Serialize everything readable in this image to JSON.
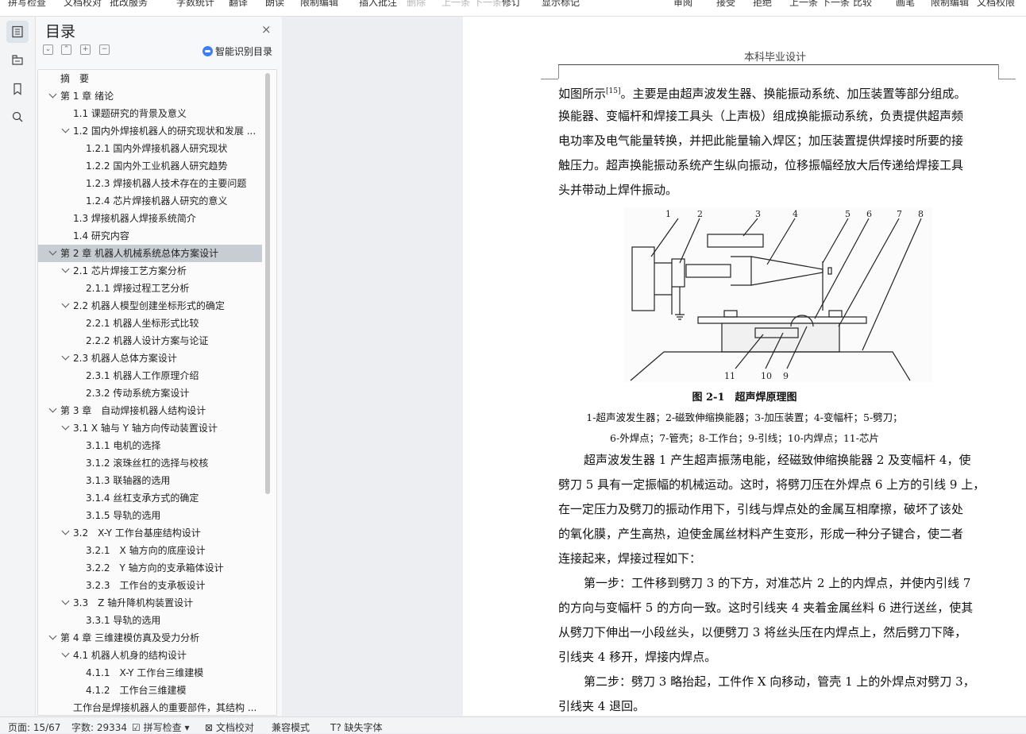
{
  "toolbar": {
    "items": [
      "拼写检查",
      "文档校对",
      "批改服务",
      "字数统计",
      "翻译",
      "朗读",
      "限制编辑",
      "插入批注",
      "删除",
      "上一条",
      "下一条",
      "修订",
      "显示标记",
      "审阅",
      "接受",
      "拒绝",
      "上一条",
      "下一条",
      "比较",
      "画笔",
      "限制编辑",
      "文档权限"
    ]
  },
  "toc": {
    "title": "目录",
    "smart_button": "智能识别目录",
    "close_symbol": "×",
    "rows": [
      {
        "level": 0,
        "chevron": false,
        "text": "摘　要"
      },
      {
        "level": 0,
        "chevron": true,
        "text": "第 1 章  绪论"
      },
      {
        "level": 1,
        "chevron": false,
        "text": "1.1  课题研究的背景及意义"
      },
      {
        "level": 1,
        "chevron": true,
        "text": "1.2  国内外焊接机器人的研究现状和发展 ..."
      },
      {
        "level": 2,
        "chevron": false,
        "text": "1.2.1  国内外焊接机器人研究现状"
      },
      {
        "level": 2,
        "chevron": false,
        "text": "1.2.2  国内外工业机器人研究趋势"
      },
      {
        "level": 2,
        "chevron": false,
        "text": "1.2.3  焊接机器人技术存在的主要问题"
      },
      {
        "level": 2,
        "chevron": false,
        "text": "1.2.4  芯片焊接机器人研究的意义"
      },
      {
        "level": 1,
        "chevron": false,
        "text": "1.3  焊接机器人焊接系统简介"
      },
      {
        "level": 1,
        "chevron": false,
        "text": "1.4  研究内容"
      },
      {
        "level": 0,
        "chevron": true,
        "text": "第 2 章  机器人机械系统总体方案设计",
        "selected": true
      },
      {
        "level": 1,
        "chevron": true,
        "text": "2.1  芯片焊接工艺方案分析"
      },
      {
        "level": 2,
        "chevron": false,
        "text": "2.1.1  焊接过程工艺分析"
      },
      {
        "level": 1,
        "chevron": true,
        "text": "2.2  机器人模型创建坐标形式的确定"
      },
      {
        "level": 2,
        "chevron": false,
        "text": "2.2.1  机器人坐标形式比较"
      },
      {
        "level": 2,
        "chevron": false,
        "text": "2.2.2  机器人设计方案与论证"
      },
      {
        "level": 1,
        "chevron": true,
        "text": "2.3  机器人总体方案设计"
      },
      {
        "level": 2,
        "chevron": false,
        "text": "2.3.1 机器人工作原理介绍"
      },
      {
        "level": 2,
        "chevron": false,
        "text": "2.3.2  传动系统方案设计"
      },
      {
        "level": 0,
        "chevron": true,
        "text": "第 3 章　自动焊接机器人结构设计"
      },
      {
        "level": 1,
        "chevron": true,
        "text": "3.1 X 轴与 Y 轴方向传动装置设计"
      },
      {
        "level": 2,
        "chevron": false,
        "text": "3.1.1  电机的选择"
      },
      {
        "level": 2,
        "chevron": false,
        "text": "3.1.2 滚珠丝杠的选择与校核"
      },
      {
        "level": 2,
        "chevron": false,
        "text": "3.1.3  联轴器的选用"
      },
      {
        "level": 2,
        "chevron": false,
        "text": "3.1.4  丝杠支承方式的确定"
      },
      {
        "level": 2,
        "chevron": false,
        "text": "3.1.5  导轨的选用"
      },
      {
        "level": 1,
        "chevron": true,
        "text": "3.2　X-Y 工作台基座结构设计"
      },
      {
        "level": 2,
        "chevron": false,
        "text": "3.2.1　X 轴方向的底座设计"
      },
      {
        "level": 2,
        "chevron": false,
        "text": "3.2.2　Y 轴方向的支承箱体设计"
      },
      {
        "level": 2,
        "chevron": false,
        "text": "3.2.3　工作台的支承板设计"
      },
      {
        "level": 1,
        "chevron": true,
        "text": "3.3　Z 轴升降机构装置设计"
      },
      {
        "level": 2,
        "chevron": false,
        "text": "3.3.1  导轨的选用"
      },
      {
        "level": 0,
        "chevron": true,
        "text": "第 4 章  三维建模仿真及受力分析"
      },
      {
        "level": 1,
        "chevron": true,
        "text": "4.1  机器人机身的结构设计"
      },
      {
        "level": 2,
        "chevron": false,
        "text": "4.1.1　X-Y 工作台三维建模"
      },
      {
        "level": 2,
        "chevron": false,
        "text": "4.1.2　工作台三维建模"
      },
      {
        "level": 1,
        "chevron": false,
        "text": "工作台是焊接机器人的重要部件，其结构 ..."
      }
    ]
  },
  "document": {
    "header": "本科毕业设计",
    "para1_lines": [
      "如图所示[15]。主要是由超声波发生器、换能振动系统、加压装置等部分组成。",
      "换能器、变幅杆和焊接工具头（上声极）组成换能振动系统，负责提供超声频",
      "电功率及电气能量转换，并把此能量输入焊区；加压装置提供焊接时所要的接",
      "触压力。超声换能振动系统产生纵向振动，位移振幅经放大后传递给焊接工具",
      "头并带动上焊件振动。"
    ],
    "figure_numbers_top": [
      "1",
      "2",
      "3",
      "4",
      "5",
      "6",
      "7",
      "8"
    ],
    "figure_numbers_bottom": [
      "11",
      "10",
      "9"
    ],
    "figure_caption": "图 2-1　超声焊原理图",
    "figure_legend_1": "1-超声波发生器；2-磁致伸缩换能器；3-加压装置；4-变幅杆；5-劈刀；",
    "figure_legend_2": "6-外焊点；7-管壳；8-工作台；9-引线；10-内焊点；11-芯片",
    "para2_lines": [
      "超声波发生器 1 产生超声振荡电能，经磁致伸缩换能器 2 及变幅杆 4，使",
      "劈刀 5 具有一定振幅的机械运动。这时，将劈刀压在外焊点 6 上方的引线 9 上，",
      "在一定压力及劈刀的振动作用下，引线与焊点处的金属互相摩擦，破坏了该处",
      "的氧化膜，产生高热，迫使金属丝材料产生变形，形成一种分子键合，使二者",
      "连接起来，焊接过程如下：",
      "第一步：工件移到劈刀 3 的下方，对准芯片 2 上的内焊点，并使内引线 7",
      "的方向与变幅杆 5 的方向一致。这时引线夹 4 夹着金属丝料 6 进行送丝，使其",
      "从劈刀下伸出一小段丝头，以便劈刀 3 将丝头压在内焊点上，然后劈刀下降，",
      "引线夹 4 移开，焊接内焊点。",
      "第二步：劈刀 3 略抬起，工件作 X 向移动，管壳 1 上的外焊点对劈刀 3，",
      "引线夹 4 退回。"
    ]
  },
  "status": {
    "page": "页面: 15/67",
    "words": "字数: 29334",
    "spell": "拼写检查",
    "proof": "文档校对",
    "compat": "兼容模式",
    "missing_font": "缺失字体"
  }
}
